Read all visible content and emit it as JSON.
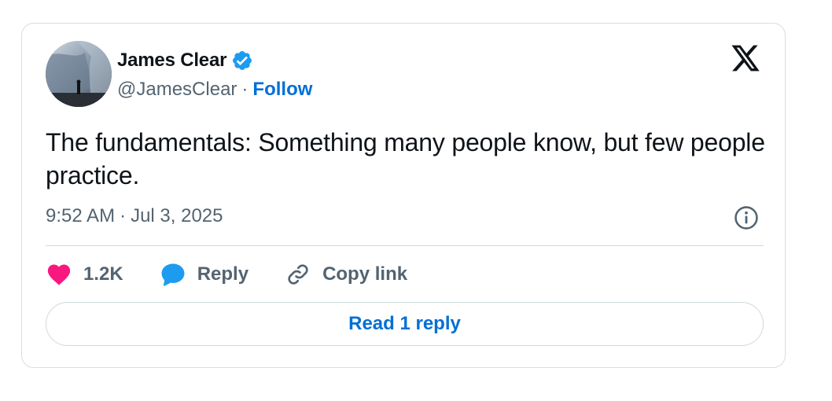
{
  "author": {
    "name": "James Clear",
    "handle": "@JamesClear",
    "separator": "·",
    "follow_label": "Follow",
    "verified": true
  },
  "tweet": {
    "text": "The fundamentals: Something many people know, but few people practice.",
    "time": "9:52 AM",
    "separator": "·",
    "date": "Jul 3, 2025"
  },
  "actions": {
    "like_count": "1.2K",
    "reply_label": "Reply",
    "copy_link_label": "Copy link"
  },
  "read_replies_label": "Read 1 reply",
  "icons": {
    "avatar": "avatar-image",
    "verified": "verified-badge-icon",
    "platform": "x-logo-icon",
    "info": "info-icon",
    "like": "heart-icon",
    "reply": "speech-bubble-icon",
    "copy": "link-icon"
  },
  "colors": {
    "accent": "#006fd6",
    "like": "#f91880",
    "reply_icon": "#1d9bf0",
    "secondary_text": "#536471",
    "primary_text": "#0f1419",
    "border": "#cfd9de"
  }
}
